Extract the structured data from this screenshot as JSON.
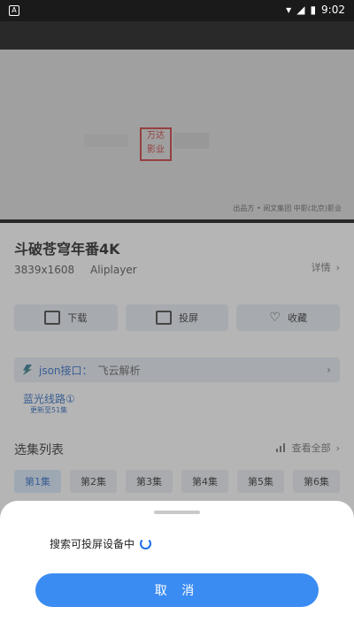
{
  "status_bar": {
    "app_icon": "A",
    "time": "9:02",
    "icons": [
      "wifi-icon",
      "signal-icon",
      "battery-icon"
    ]
  },
  "video": {
    "credit_text": "出品方 • 阅文集团 中影(北京)影业"
  },
  "title": "斗破苍穹年番4K",
  "resolution": "3839x1608",
  "player": "Aliplayer",
  "details_label": "详情",
  "actions": [
    {
      "label": "下载",
      "icon": "download-icon"
    },
    {
      "label": "投屏",
      "icon": "cast-icon"
    },
    {
      "label": "收藏",
      "icon": "heart-icon"
    }
  ],
  "json_interface": {
    "label": "json接口：",
    "value": "飞云解析"
  },
  "route": {
    "title": "蓝光线路①",
    "subtitle": "更新至51集"
  },
  "episode_list": {
    "title": "选集列表",
    "view_all": "查看全部"
  },
  "episodes": [
    "第1集",
    "第2集",
    "第3集",
    "第4集",
    "第5集",
    "第6集"
  ],
  "sheet": {
    "searching_text": "搜索可投屏设备中",
    "cancel_label": "取 消"
  },
  "colors": {
    "accent": "#3b8cf2",
    "link": "#1e5fbf"
  }
}
